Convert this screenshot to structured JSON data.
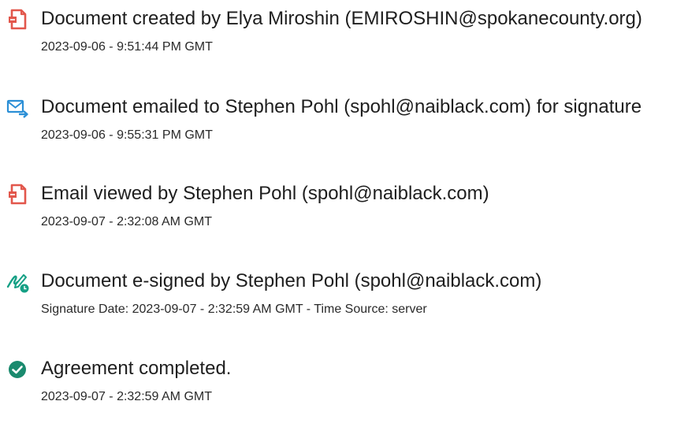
{
  "audit_events": [
    {
      "icon": "document-icon",
      "title": "Document created by Elya Miroshin (EMIROSHIN@spokanecounty.org)",
      "detail": "2023-09-06 - 9:51:44 PM GMT"
    },
    {
      "icon": "email-send-icon",
      "title": "Document emailed to Stephen Pohl (spohl@naiblack.com) for signature",
      "detail": "2023-09-06 - 9:55:31 PM GMT"
    },
    {
      "icon": "document-icon",
      "title": "Email viewed by Stephen Pohl (spohl@naiblack.com)",
      "detail": "2023-09-07 - 2:32:08 AM GMT"
    },
    {
      "icon": "signature-pen-icon",
      "title": "Document e-signed by Stephen Pohl (spohl@naiblack.com)",
      "detail": "Signature Date: 2023-09-07 - 2:32:59 AM GMT - Time Source: server"
    },
    {
      "icon": "check-circle-icon",
      "title": "Agreement completed.",
      "detail": "2023-09-07 - 2:32:59 AM GMT"
    }
  ],
  "colors": {
    "document_icon": "#e2574c",
    "email_icon": "#2b8fd6",
    "signature_icon": "#16a085",
    "complete_icon": "#1a8a6e",
    "text": "#1e1e1e"
  }
}
